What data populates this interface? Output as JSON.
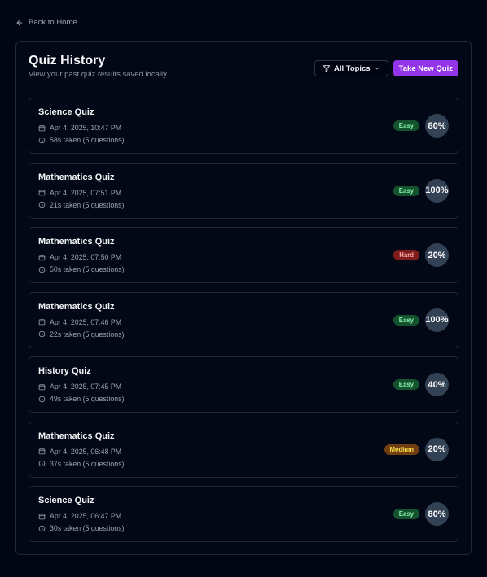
{
  "nav": {
    "back_label": "Back to Home"
  },
  "header": {
    "title": "Quiz History",
    "subtitle": "View your past quiz results saved locally",
    "filter_label": "All Topics",
    "new_quiz_label": "Take New Quiz"
  },
  "colors": {
    "background": "#020613",
    "accent": "#9333ea",
    "easy": "#14532d",
    "hard": "#7f1d1d",
    "medium": "#713f12",
    "score_bg": "#334155"
  },
  "quizzes": [
    {
      "title": "Science Quiz",
      "date": "Apr 4, 2025, 10:47 PM",
      "duration": "58s taken (5 questions)",
      "difficulty": "Easy",
      "score": "80%"
    },
    {
      "title": "Mathematics Quiz",
      "date": "Apr 4, 2025, 07:51 PM",
      "duration": "21s taken (5 questions)",
      "difficulty": "Easy",
      "score": "100%"
    },
    {
      "title": "Mathematics Quiz",
      "date": "Apr 4, 2025, 07:50 PM",
      "duration": "50s taken (5 questions)",
      "difficulty": "Hard",
      "score": "20%"
    },
    {
      "title": "Mathematics Quiz",
      "date": "Apr 4, 2025, 07:46 PM",
      "duration": "22s taken (5 questions)",
      "difficulty": "Easy",
      "score": "100%"
    },
    {
      "title": "History Quiz",
      "date": "Apr 4, 2025, 07:45 PM",
      "duration": "49s taken (5 questions)",
      "difficulty": "Easy",
      "score": "40%"
    },
    {
      "title": "Mathematics Quiz",
      "date": "Apr 4, 2025, 06:48 PM",
      "duration": "37s taken (5 questions)",
      "difficulty": "Medium",
      "score": "20%"
    },
    {
      "title": "Science Quiz",
      "date": "Apr 4, 2025, 06:47 PM",
      "duration": "30s taken (5 questions)",
      "difficulty": "Easy",
      "score": "80%"
    }
  ]
}
